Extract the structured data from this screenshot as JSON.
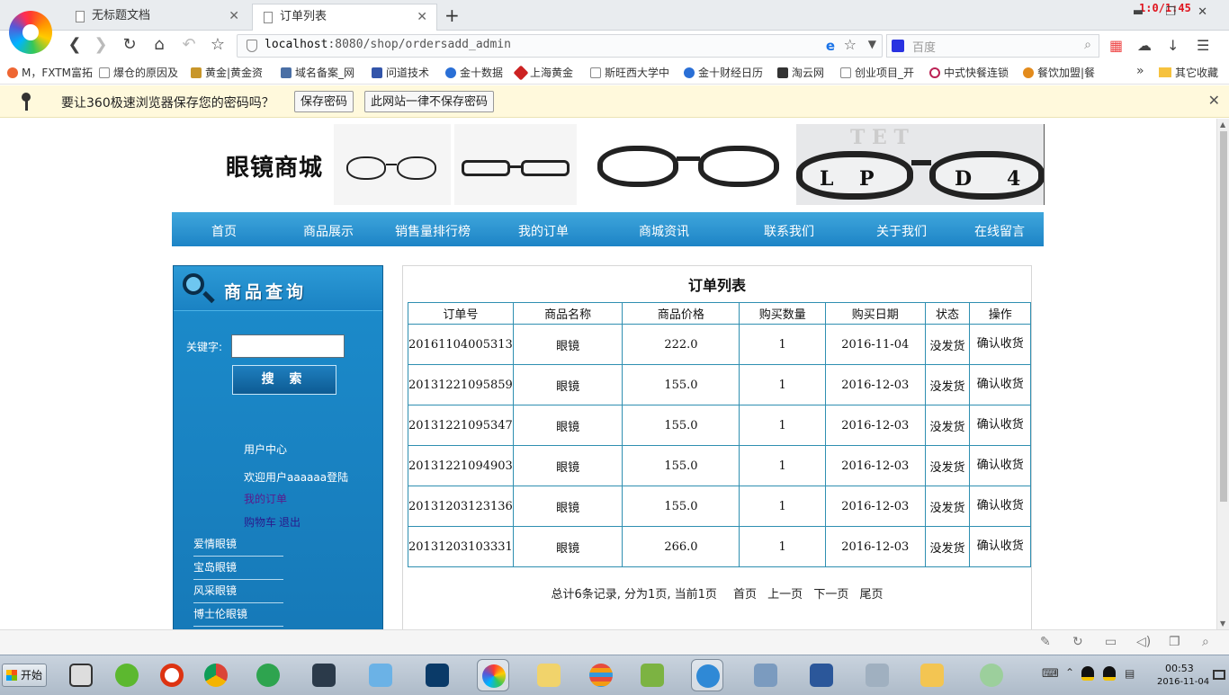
{
  "browser": {
    "tabs": [
      {
        "title": "无标题文档",
        "active": false
      },
      {
        "title": "订单列表",
        "active": true
      }
    ],
    "timer": "1:0/1:45",
    "address": {
      "host": "localhost",
      "rest": ":8080/shop/ordersadd_admin"
    },
    "search_placeholder": "百度",
    "bookmarks": [
      "M，FXTM富拓",
      "爆仓的原因及",
      "黄金|黄金资",
      "域名备案_网",
      "问道技术",
      "金十数据",
      "上海黄金",
      "斯旺西大学中",
      "金十财经日历",
      "淘云网",
      "创业项目_开",
      "中式快餐连锁",
      "餐饮加盟|餐"
    ],
    "bookmarks_more": "»",
    "bookmarks_other": "其它收藏",
    "password_bar": {
      "message": "要让360极速浏览器保存您的密码吗？",
      "save": "保存密码",
      "never": "此网站一律不保存密码"
    }
  },
  "site": {
    "title": "眼镜商城",
    "banner_letters": [
      "L",
      "P",
      "D",
      "4"
    ],
    "nav": [
      "首页",
      "商品展示",
      "销售量排行榜",
      "我的订单",
      "商城资讯",
      "联系我们",
      "关于我们",
      "在线留言"
    ]
  },
  "sidebar": {
    "title": "商品查询",
    "keyword_label": "关键字:",
    "search_button": "搜 索",
    "user_center": "用户中心",
    "welcome": "欢迎用户aaaaaa登陆",
    "my_orders": "我的订单",
    "cart": "购物车",
    "logout": "退出",
    "categories": [
      "爱情眼镜",
      "宝岛眼镜",
      "风采眼镜",
      "博士伦眼镜"
    ]
  },
  "orders": {
    "title": "订单列表",
    "headers": [
      "订单号",
      "商品名称",
      "商品价格",
      "购买数量",
      "购买日期",
      "状态",
      "操作"
    ],
    "rows": [
      {
        "id": "20161104005313",
        "name": "眼镜",
        "price": "222.0",
        "qty": "1",
        "date": "2016-11-04",
        "status": "没发货",
        "action": "确认收货"
      },
      {
        "id": "20131221095859",
        "name": "眼镜",
        "price": "155.0",
        "qty": "1",
        "date": "2016-12-03",
        "status": "没发货",
        "action": "确认收货"
      },
      {
        "id": "20131221095347",
        "name": "眼镜",
        "price": "155.0",
        "qty": "1",
        "date": "2016-12-03",
        "status": "没发货",
        "action": "确认收货"
      },
      {
        "id": "20131221094903",
        "name": "眼镜",
        "price": "155.0",
        "qty": "1",
        "date": "2016-12-03",
        "status": "没发货",
        "action": "确认收货"
      },
      {
        "id": "20131203123136",
        "name": "眼镜",
        "price": "155.0",
        "qty": "1",
        "date": "2016-12-03",
        "status": "没发货",
        "action": "确认收货"
      },
      {
        "id": "20131203103331",
        "name": "眼镜",
        "price": "266.0",
        "qty": "1",
        "date": "2016-12-03",
        "status": "没发货",
        "action": "确认收货"
      }
    ],
    "pager_info": "总计6条记录, 分为1页, 当前1页",
    "pager_links": [
      "首页",
      "上一页",
      "下一页",
      "尾页"
    ]
  },
  "taskbar": {
    "start": "开始",
    "time": "00:53",
    "date": "2016-11-04"
  },
  "colors": {
    "nav_blue": "#1d84c6",
    "sidebar_blue": "#1c8ccc",
    "table_border": "#2f8fb1",
    "timer_red": "#e0141e",
    "infobar_bg": "#fff9dc"
  }
}
